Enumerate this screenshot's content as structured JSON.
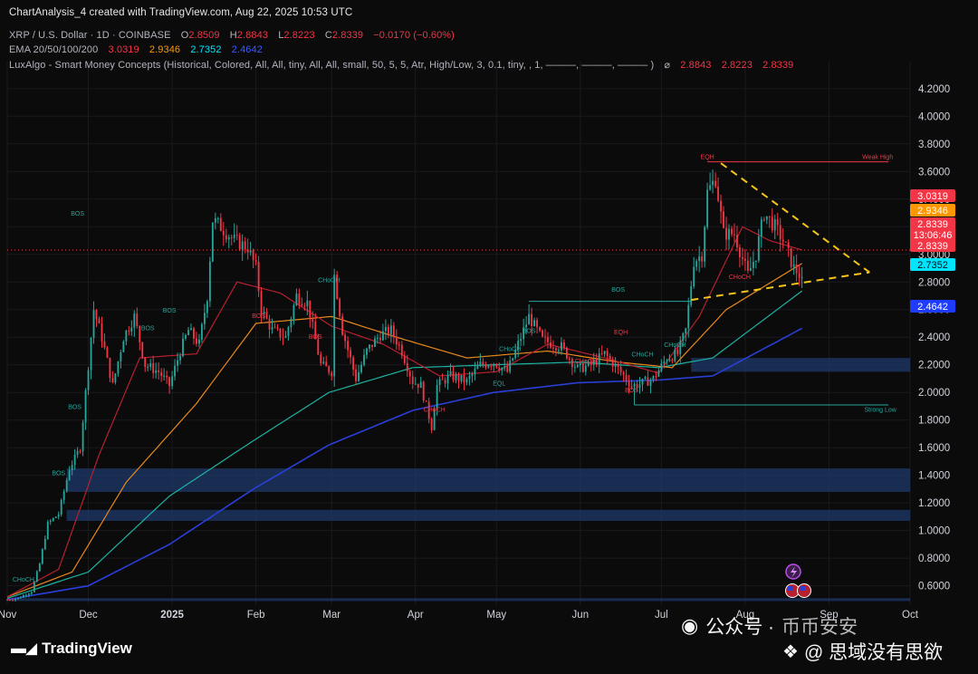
{
  "header": {
    "credit": "ChartAnalysis_4 created with TradingView.com, Aug 22, 2025 10:53 UTC",
    "symbol": "XRP / U.S. Dollar · 1D · COINBASE",
    "o_label": "O",
    "o_value": "2.8509",
    "h_label": "H",
    "h_value": "2.8843",
    "l_label": "L",
    "l_value": "2.8223",
    "c_label": "C",
    "c_value": "2.8339",
    "change": "−0.0170 (−0.60%)",
    "ema_label": "EMA 20/50/100/200",
    "ema_values": [
      "3.0319",
      "2.9346",
      "2.7352",
      "2.4642"
    ],
    "lux_label": "LuxAlgo - Smart Money Concepts (Historical, Colored, All, All, tiny, All, All, small, 50, 5, 5, Atr, High/Low, 3, 0.1, tiny, , 1, ———, ———, ——— )",
    "lux_symbol": "⌀",
    "lux_values": [
      "2.8843",
      "2.8223",
      "2.8339"
    ]
  },
  "price_tags": [
    {
      "text": "3.0319",
      "value": 3.0319,
      "bg": "#f23645",
      "fg": "#ffffff"
    },
    {
      "text": "2.9346",
      "value": 2.9346,
      "bg": "#ff9800",
      "fg": "#ffffff"
    },
    {
      "text": "2.8339",
      "value": 2.8339,
      "bg": "#f23645",
      "fg": "#ffffff",
      "sub": "13:06:46",
      "sub2": "2.8339"
    },
    {
      "text": "2.7352",
      "value": 2.7352,
      "bg": "#00e5ff",
      "fg": "#0b0b0c"
    },
    {
      "text": "2.4642",
      "value": 2.4642,
      "bg": "#1e3cff",
      "fg": "#ffffff"
    }
  ],
  "annotations": [
    {
      "text": "EQH",
      "date": "2025-07-18",
      "y": 3.69,
      "color": "#f23645"
    },
    {
      "text": "Weak High",
      "date": "2025-09-19",
      "y": 3.69,
      "color": "#f23645"
    },
    {
      "text": "BOS",
      "date": "2025-06-15",
      "y": 2.73,
      "color": "#26a69a"
    },
    {
      "text": "CHoCH",
      "date": "2025-02-28",
      "y": 2.8,
      "color": "#26a69a"
    },
    {
      "text": "CHoCH",
      "date": "2025-07-30",
      "y": 2.82,
      "color": "#f23645"
    },
    {
      "text": "BOS",
      "date": "2024-12-31",
      "y": 2.58,
      "color": "#26a69a"
    },
    {
      "text": "BOS",
      "date": "2024-12-23",
      "y": 2.45,
      "color": "#26a69a"
    },
    {
      "text": "BOS",
      "date": "2025-02-02",
      "y": 2.54,
      "color": "#f23645"
    },
    {
      "text": "BOS",
      "date": "2025-02-23",
      "y": 2.39,
      "color": "#f23645"
    },
    {
      "text": "CHoCH",
      "date": "2025-04-08",
      "y": 1.86,
      "color": "#f23645"
    },
    {
      "text": "CHoCH",
      "date": "2025-05-06",
      "y": 2.3,
      "color": "#26a69a"
    },
    {
      "text": "BOS",
      "date": "2025-05-13",
      "y": 2.43,
      "color": "#26a69a"
    },
    {
      "text": "EQL",
      "date": "2025-05-02",
      "y": 2.05,
      "color": "#26a69a"
    },
    {
      "text": "CHoCH",
      "date": "2025-06-03",
      "y": 2.21,
      "color": "#f23645"
    },
    {
      "text": "CHoCH",
      "date": "2025-06-24",
      "y": 2.26,
      "color": "#26a69a"
    },
    {
      "text": "EQH",
      "date": "2025-06-16",
      "y": 2.42,
      "color": "#f23645"
    },
    {
      "text": "CHoCH",
      "date": "2025-07-06",
      "y": 2.33,
      "color": "#26a69a"
    },
    {
      "text": "BOS",
      "date": "2025-06-20",
      "y": 2.0,
      "color": "#f23645"
    },
    {
      "text": "BOS",
      "date": "2024-11-27",
      "y": 3.28,
      "color": "#26a69a"
    },
    {
      "text": "BOS",
      "date": "2024-11-20",
      "y": 1.4,
      "color": "#26a69a"
    },
    {
      "text": "BOS",
      "date": "2024-11-26",
      "y": 1.88,
      "color": "#26a69a"
    },
    {
      "text": "CHoCH",
      "date": "2024-11-07",
      "y": 0.63,
      "color": "#26a69a"
    },
    {
      "text": "Strong Low",
      "date": "2025-09-20",
      "y": 1.86,
      "color": "#26a69a"
    }
  ],
  "chart_data": {
    "type": "line",
    "title": "XRP / U.S. Dollar · 1D · COINBASE",
    "x_ticks": [
      {
        "label": "Nov",
        "date": "2024-11-01",
        "bold": false
      },
      {
        "label": "Dec",
        "date": "2024-12-01",
        "bold": false
      },
      {
        "label": "2025",
        "date": "2025-01-01",
        "bold": true
      },
      {
        "label": "Feb",
        "date": "2025-02-01",
        "bold": false
      },
      {
        "label": "Mar",
        "date": "2025-03-01",
        "bold": false
      },
      {
        "label": "Apr",
        "date": "2025-04-01",
        "bold": false
      },
      {
        "label": "May",
        "date": "2025-05-01",
        "bold": false
      },
      {
        "label": "Jun",
        "date": "2025-06-01",
        "bold": false
      },
      {
        "label": "Jul",
        "date": "2025-07-01",
        "bold": false
      },
      {
        "label": "Aug",
        "date": "2025-08-01",
        "bold": false
      },
      {
        "label": "Sep",
        "date": "2025-09-01",
        "bold": false
      },
      {
        "label": "Oct",
        "date": "2025-10-01",
        "bold": false
      }
    ],
    "y_ticks": [
      "4.2000",
      "4.0000",
      "3.8000",
      "3.6000",
      "3.4000",
      "3.2000",
      "3.0000",
      "2.8000",
      "2.6000",
      "2.4000",
      "2.2000",
      "2.0000",
      "1.8000",
      "1.6000",
      "1.4000",
      "1.2000",
      "1.0000",
      "0.8000",
      "0.6000"
    ],
    "ylim": [
      0.46,
      4.33
    ],
    "xlim": [
      "2024-11-01",
      "2025-10-01"
    ],
    "colors": {
      "up": "#26a69a",
      "down": "#f23645",
      "ema20": "#b7202e",
      "ema50": "#e8891c",
      "ema100": "#1db3a0",
      "ema200": "#2a3fd8",
      "zone": "#1f3a6b",
      "trend": "#f5c518",
      "grid": "#1b1b1e"
    },
    "close_anchors": [
      [
        "2024-11-01",
        0.5
      ],
      [
        "2024-11-05",
        0.51
      ],
      [
        "2024-11-10",
        0.56
      ],
      [
        "2024-11-13",
        0.76
      ],
      [
        "2024-11-16",
        1.05
      ],
      [
        "2024-11-20",
        1.12
      ],
      [
        "2024-11-24",
        1.45
      ],
      [
        "2024-11-28",
        1.6
      ],
      [
        "2024-12-01",
        2.2
      ],
      [
        "2024-12-03",
        2.6
      ],
      [
        "2024-12-06",
        2.4
      ],
      [
        "2024-12-10",
        2.05
      ],
      [
        "2024-12-14",
        2.4
      ],
      [
        "2024-12-18",
        2.55
      ],
      [
        "2024-12-22",
        2.2
      ],
      [
        "2024-12-27",
        2.15
      ],
      [
        "2024-12-31",
        2.05
      ],
      [
        "2025-01-04",
        2.3
      ],
      [
        "2025-01-07",
        2.45
      ],
      [
        "2025-01-11",
        2.35
      ],
      [
        "2025-01-14",
        2.7
      ],
      [
        "2025-01-16",
        3.25
      ],
      [
        "2025-01-19",
        3.2
      ],
      [
        "2025-01-24",
        3.1
      ],
      [
        "2025-01-29",
        3.05
      ],
      [
        "2025-02-01",
        2.9
      ],
      [
        "2025-02-03",
        2.6
      ],
      [
        "2025-02-07",
        2.45
      ],
      [
        "2025-02-12",
        2.4
      ],
      [
        "2025-02-16",
        2.7
      ],
      [
        "2025-02-20",
        2.65
      ],
      [
        "2025-02-25",
        2.2
      ],
      [
        "2025-03-01",
        2.15
      ],
      [
        "2025-03-02",
        2.85
      ],
      [
        "2025-03-05",
        2.45
      ],
      [
        "2025-03-10",
        2.1
      ],
      [
        "2025-03-14",
        2.3
      ],
      [
        "2025-03-19",
        2.42
      ],
      [
        "2025-03-23",
        2.45
      ],
      [
        "2025-03-27",
        2.3
      ],
      [
        "2025-03-31",
        2.08
      ],
      [
        "2025-04-03",
        2.05
      ],
      [
        "2025-04-07",
        1.75
      ],
      [
        "2025-04-09",
        2.05
      ],
      [
        "2025-04-14",
        2.12
      ],
      [
        "2025-04-20",
        2.08
      ],
      [
        "2025-04-25",
        2.2
      ],
      [
        "2025-04-30",
        2.22
      ],
      [
        "2025-05-05",
        2.15
      ],
      [
        "2025-05-10",
        2.4
      ],
      [
        "2025-05-13",
        2.55
      ],
      [
        "2025-05-18",
        2.38
      ],
      [
        "2025-05-25",
        2.33
      ],
      [
        "2025-05-31",
        2.17
      ],
      [
        "2025-06-05",
        2.2
      ],
      [
        "2025-06-10",
        2.28
      ],
      [
        "2025-06-15",
        2.17
      ],
      [
        "2025-06-20",
        2.05
      ],
      [
        "2025-06-23",
        2.06
      ],
      [
        "2025-06-28",
        2.1
      ],
      [
        "2025-07-03",
        2.25
      ],
      [
        "2025-07-07",
        2.28
      ],
      [
        "2025-07-10",
        2.45
      ],
      [
        "2025-07-13",
        2.95
      ],
      [
        "2025-07-16",
        3.0
      ],
      [
        "2025-07-18",
        3.45
      ],
      [
        "2025-07-21",
        3.55
      ],
      [
        "2025-07-24",
        3.15
      ],
      [
        "2025-07-28",
        3.15
      ],
      [
        "2025-08-02",
        2.85
      ],
      [
        "2025-08-05",
        3.0
      ],
      [
        "2025-08-08",
        3.3
      ],
      [
        "2025-08-12",
        3.2
      ],
      [
        "2025-08-15",
        3.1
      ],
      [
        "2025-08-19",
        2.9
      ],
      [
        "2025-08-22",
        2.8339
      ]
    ],
    "ema_anchors": {
      "ema20": [
        [
          "2024-11-01",
          0.52
        ],
        [
          "2024-11-20",
          0.72
        ],
        [
          "2024-12-05",
          1.55
        ],
        [
          "2024-12-20",
          2.25
        ],
        [
          "2025-01-10",
          2.28
        ],
        [
          "2025-01-25",
          2.8
        ],
        [
          "2025-02-10",
          2.72
        ],
        [
          "2025-03-01",
          2.48
        ],
        [
          "2025-03-20",
          2.35
        ],
        [
          "2025-04-10",
          2.12
        ],
        [
          "2025-05-01",
          2.15
        ],
        [
          "2025-05-20",
          2.35
        ],
        [
          "2025-06-10",
          2.25
        ],
        [
          "2025-06-30",
          2.14
        ],
        [
          "2025-07-15",
          2.55
        ],
        [
          "2025-07-31",
          3.2
        ],
        [
          "2025-08-10",
          3.1
        ],
        [
          "2025-08-22",
          3.0319
        ]
      ],
      "ema50": [
        [
          "2024-11-01",
          0.52
        ],
        [
          "2024-11-25",
          0.7
        ],
        [
          "2024-12-15",
          1.35
        ],
        [
          "2025-01-10",
          1.92
        ],
        [
          "2025-02-01",
          2.5
        ],
        [
          "2025-03-01",
          2.55
        ],
        [
          "2025-03-25",
          2.4
        ],
        [
          "2025-04-20",
          2.25
        ],
        [
          "2025-05-20",
          2.3
        ],
        [
          "2025-06-15",
          2.22
        ],
        [
          "2025-07-05",
          2.18
        ],
        [
          "2025-07-25",
          2.6
        ],
        [
          "2025-08-22",
          2.9346
        ]
      ],
      "ema100": [
        [
          "2024-11-01",
          0.51
        ],
        [
          "2024-12-01",
          0.7
        ],
        [
          "2024-12-31",
          1.25
        ],
        [
          "2025-01-31",
          1.65
        ],
        [
          "2025-02-28",
          2.0
        ],
        [
          "2025-03-31",
          2.18
        ],
        [
          "2025-04-30",
          2.2
        ],
        [
          "2025-05-31",
          2.22
        ],
        [
          "2025-06-30",
          2.18
        ],
        [
          "2025-07-20",
          2.25
        ],
        [
          "2025-08-22",
          2.7352
        ]
      ],
      "ema200": [
        [
          "2024-11-01",
          0.5
        ],
        [
          "2024-12-01",
          0.6
        ],
        [
          "2024-12-31",
          0.9
        ],
        [
          "2025-01-31",
          1.3
        ],
        [
          "2025-02-28",
          1.62
        ],
        [
          "2025-03-31",
          1.87
        ],
        [
          "2025-04-30",
          2.0
        ],
        [
          "2025-05-31",
          2.07
        ],
        [
          "2025-06-30",
          2.09
        ],
        [
          "2025-07-20",
          2.12
        ],
        [
          "2025-08-22",
          2.4642
        ]
      ]
    },
    "zones": [
      {
        "date_start": "2024-11-23",
        "date_end": "2025-10-01",
        "y_low": 1.28,
        "y_high": 1.45
      },
      {
        "date_start": "2024-11-23",
        "date_end": "2025-10-01",
        "y_low": 1.07,
        "y_high": 1.15
      },
      {
        "date_start": "2025-07-12",
        "date_end": "2025-10-01",
        "y_low": 2.15,
        "y_high": 2.25
      },
      {
        "date_start": "2024-11-01",
        "date_end": "2025-10-01",
        "y_low": 0.49,
        "y_high": 0.51
      }
    ],
    "trendlines": [
      {
        "from": [
          "2025-07-23",
          3.66
        ],
        "to": [
          "2025-09-16",
          2.87
        ]
      },
      {
        "from": [
          "2025-07-12",
          2.67
        ],
        "to": [
          "2025-09-16",
          2.87
        ]
      }
    ],
    "levels": [
      {
        "from": [
          "2025-07-18",
          3.67
        ],
        "to": [
          "2025-09-23",
          3.67
        ],
        "color": "#f23645"
      },
      {
        "from": [
          "2025-06-21",
          1.91
        ],
        "to": [
          "2025-09-23",
          1.91
        ],
        "color": "#26a69a"
      },
      {
        "from": [
          "2025-05-13",
          2.66
        ],
        "to": [
          "2025-07-12",
          2.66
        ],
        "color": "#26a69a"
      },
      {
        "from": [
          "2025-06-21",
          1.91
        ],
        "to": [
          "2025-06-21",
          2.06
        ],
        "color": "#26a69a"
      }
    ],
    "last_close": 2.8339
  }
}
